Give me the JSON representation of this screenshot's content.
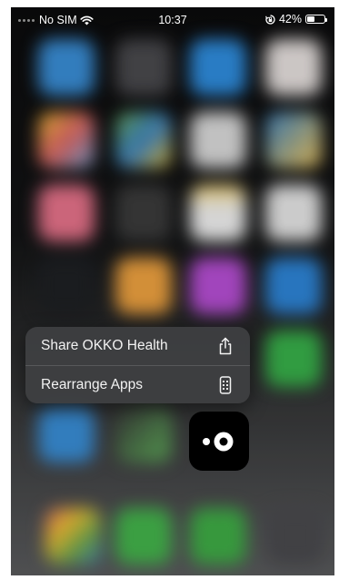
{
  "status_bar": {
    "carrier": "No SIM",
    "time": "10:37",
    "battery_percent": "42%",
    "battery_level": 0.42,
    "icons": [
      "signal-dots-icon",
      "wifi-icon",
      "orientation-lock-icon",
      "battery-icon"
    ]
  },
  "context_menu": {
    "items": [
      {
        "label": "Share OKKO Health",
        "icon": "share-icon"
      },
      {
        "label": "Rearrange Apps",
        "icon": "phone-icon"
      }
    ]
  },
  "app": {
    "icon": "okko-health-logo"
  },
  "colors": {
    "menu_background": "#3e3f41",
    "menu_text": "#f2f2f2",
    "app_tile": "#000000"
  }
}
